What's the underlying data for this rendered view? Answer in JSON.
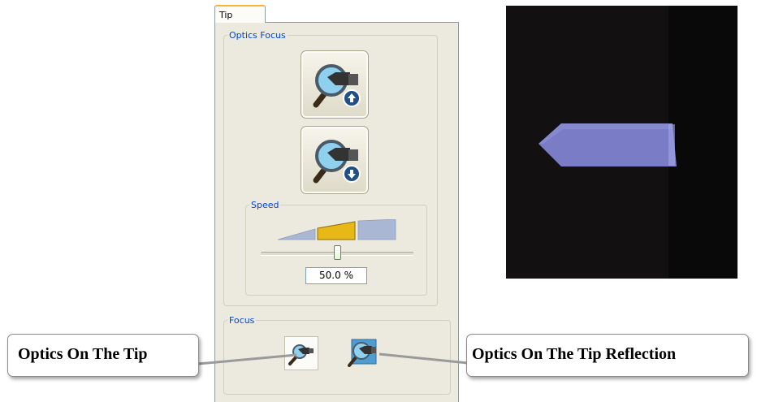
{
  "tab": {
    "label": "Tip"
  },
  "optics_focus": {
    "legend": "Optics Focus",
    "up_button_icon": "magnifier-focus-up-icon",
    "down_button_icon": "magnifier-focus-down-icon"
  },
  "speed": {
    "legend": "Speed",
    "value_text": "50.0 %",
    "level": 0.5,
    "selected_segment": 2
  },
  "focus": {
    "legend": "Focus",
    "buttons": [
      {
        "icon": "optics-on-tip-icon",
        "selected": true
      },
      {
        "icon": "optics-on-tip-reflection-icon",
        "selected": false
      }
    ]
  },
  "callouts": {
    "left": "Optics On The Tip",
    "right": "Optics On The Tip Reflection"
  },
  "colors": {
    "legend_text": "#0046d5",
    "panel_bg": "#eceade",
    "speed_selected": "#e8b817",
    "speed_ramp": "#a9b6d4",
    "camera_bg": "#121011",
    "tip_color": "#7a7cc6"
  }
}
